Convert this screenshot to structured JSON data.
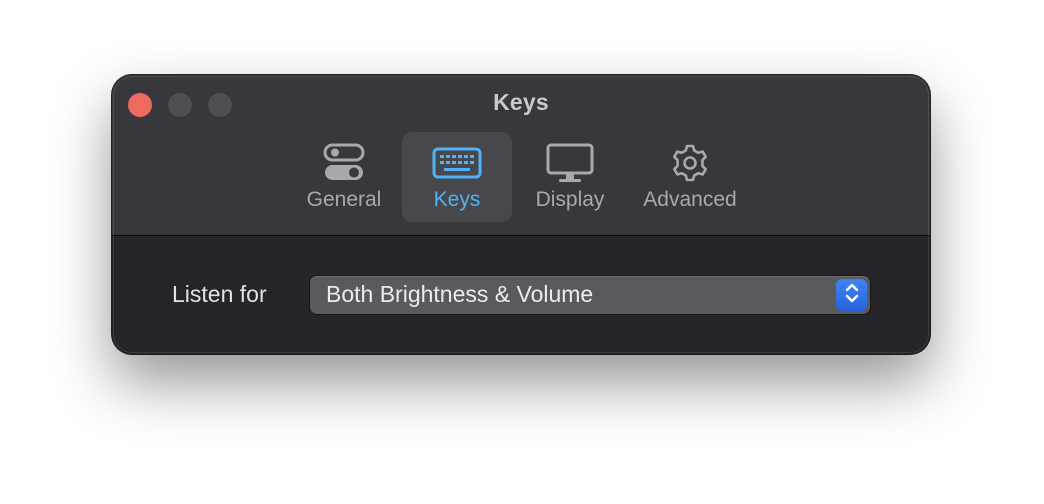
{
  "window": {
    "title": "Keys"
  },
  "toolbar": {
    "tabs": [
      {
        "label": "General",
        "icon": "toggle-switches-icon",
        "selected": false
      },
      {
        "label": "Keys",
        "icon": "keyboard-icon",
        "selected": true
      },
      {
        "label": "Display",
        "icon": "display-icon",
        "selected": false
      },
      {
        "label": "Advanced",
        "icon": "gear-icon",
        "selected": false
      }
    ]
  },
  "content": {
    "listen_for": {
      "label": "Listen for",
      "value": "Both Brightness & Volume"
    }
  },
  "colors": {
    "accent": "#4fb3f6",
    "close": "#ec6a5e",
    "stepper": "#2f6ee8"
  }
}
